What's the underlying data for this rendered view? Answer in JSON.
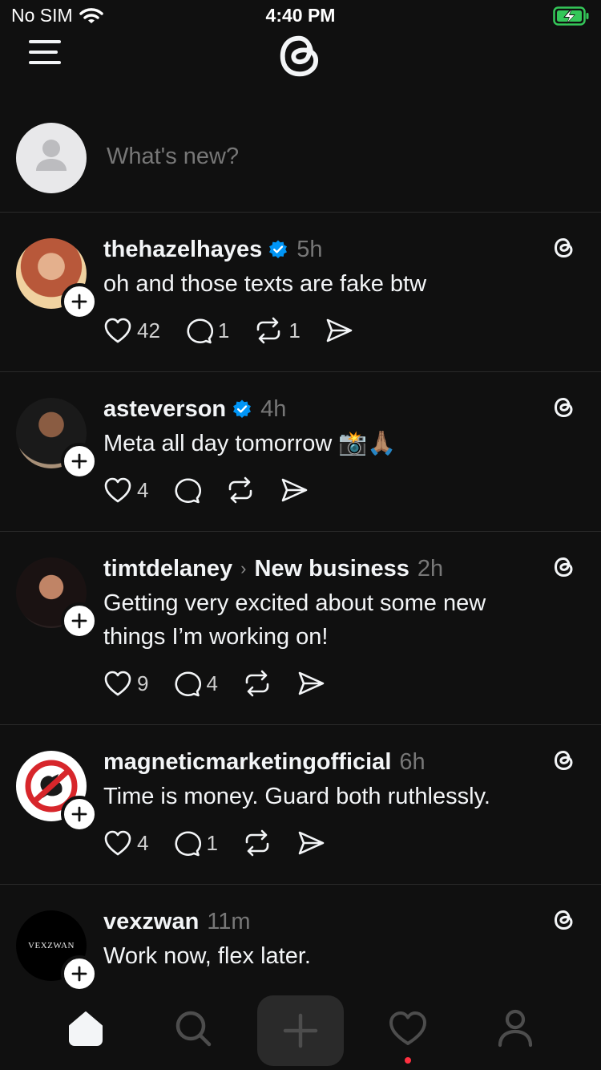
{
  "status_bar": {
    "carrier": "No SIM",
    "time": "4:40 PM",
    "battery_color": "#34c759"
  },
  "composer": {
    "placeholder": "What's new?"
  },
  "posts": [
    {
      "username": "thehazelhayes",
      "verified": true,
      "time": "5h",
      "text": "oh and those texts are fake btw",
      "likes": "42",
      "replies": "1",
      "reposts": "1",
      "avatar_color": "#c27a5a"
    },
    {
      "username": "asteverson",
      "verified": true,
      "time": "4h",
      "text": "Meta all day tomorrow 📸🙏🏽",
      "likes": "4",
      "replies": "",
      "reposts": "",
      "avatar_color": "#6b5a4a"
    },
    {
      "username": "timtdelaney",
      "verified": false,
      "topic": "New business",
      "time": "2h",
      "text": "Getting very excited about some new things I’m working on!",
      "likes": "9",
      "replies": "4",
      "reposts": "",
      "avatar_color": "#3a2e2a"
    },
    {
      "username": "magneticmarketingofficial",
      "verified": false,
      "time": "6h",
      "text": "Time is money. Guard both ruthlessly.",
      "likes": "4",
      "replies": "1",
      "reposts": "",
      "avatar_color": "#ffffff"
    },
    {
      "username": "vexzwan",
      "verified": false,
      "time": "11m",
      "text": "Work now, flex later.",
      "avatar_logo_text": "VEXZWAN",
      "avatar_color": "#000000"
    }
  ],
  "colors": {
    "background": "#101010",
    "verified": "#0095f6",
    "notification_dot": "#ff3040"
  }
}
